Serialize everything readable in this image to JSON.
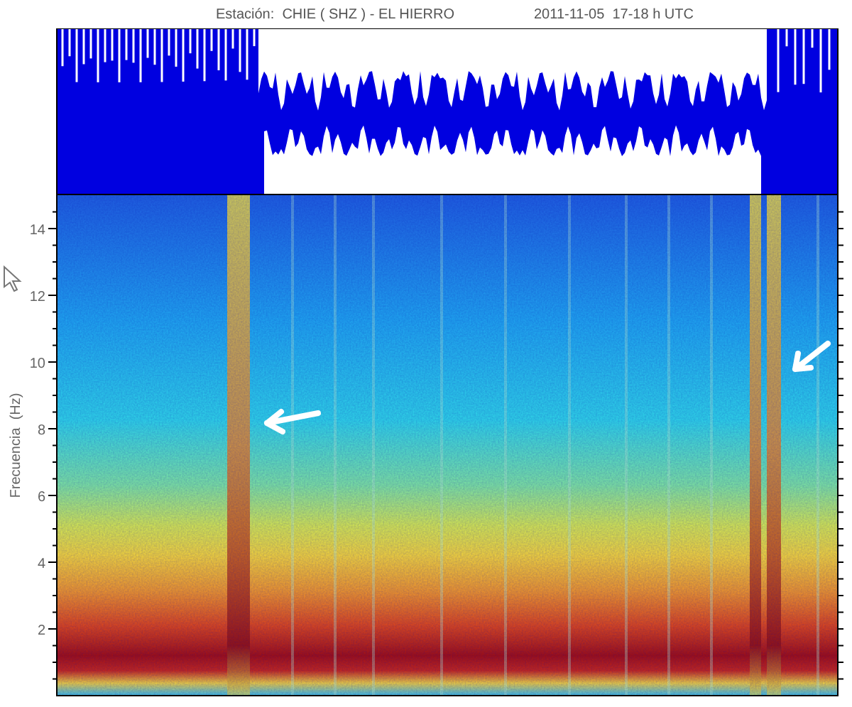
{
  "header": {
    "station": "Estación:  CHIE ( SHZ ) - EL HIERRO",
    "datetime": "2011-11-05  17-18 h UTC"
  },
  "spectrogram": {
    "ylabel": "Frecuencia  (Hz)",
    "yticks": [
      "14",
      "12",
      "10",
      "8",
      "6",
      "4",
      "2"
    ]
  }
}
